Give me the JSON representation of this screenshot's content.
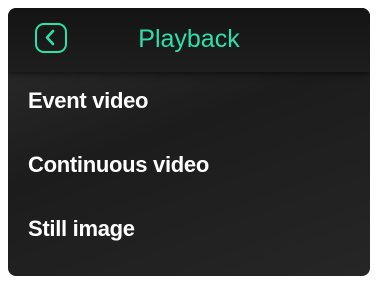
{
  "header": {
    "title": "Playback",
    "back_icon": "chevron-left-icon",
    "accent_color": "#2de0a7"
  },
  "menu": {
    "items": [
      {
        "label": "Event video"
      },
      {
        "label": "Continuous video"
      },
      {
        "label": "Still image"
      }
    ]
  }
}
